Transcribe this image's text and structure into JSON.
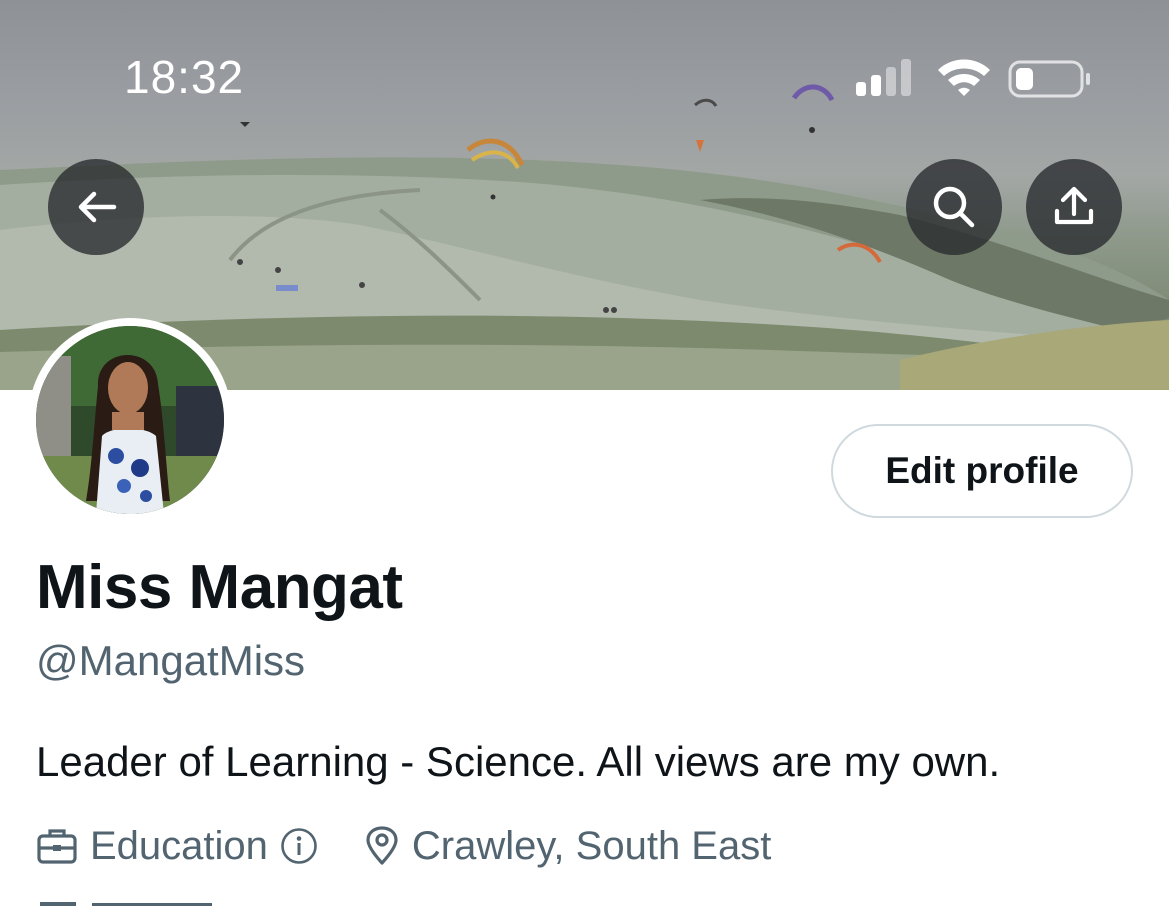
{
  "status_bar": {
    "time": "18:32",
    "icons": [
      "cellular-signal-icon",
      "wifi-icon",
      "battery-icon"
    ]
  },
  "header": {
    "back_icon": "arrow-left-icon",
    "search_icon": "search-icon",
    "share_icon": "share-upload-icon"
  },
  "profile": {
    "display_name": "Miss Mangat",
    "handle": "@MangatMiss",
    "bio": "Leader of Learning - Science. All views are my own.",
    "category": "Education",
    "location": "Crawley, South East",
    "edit_label": "Edit profile"
  },
  "colors": {
    "text_primary": "#0f1419",
    "text_secondary": "#536471",
    "button_border": "#cfd9de",
    "overlay_button": "#2b2d31"
  }
}
